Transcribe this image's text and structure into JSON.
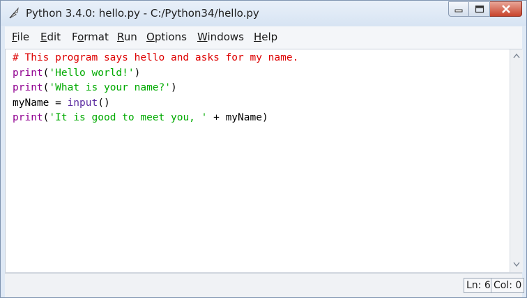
{
  "window": {
    "title": "Python 3.4.0: hello.py - C:/Python34/hello.py"
  },
  "menu": {
    "file": {
      "accel": "F",
      "rest": "ile"
    },
    "edit": {
      "accel": "E",
      "rest": "dit"
    },
    "format": {
      "pre": "F",
      "accel": "o",
      "rest": "rmat"
    },
    "run": {
      "accel": "R",
      "rest": "un"
    },
    "options": {
      "accel": "O",
      "rest": "ptions"
    },
    "windows": {
      "accel": "W",
      "rest": "indows"
    },
    "help": {
      "accel": "H",
      "rest": "elp"
    }
  },
  "code": {
    "line1": {
      "comment": "# This program says hello and asks for my name."
    },
    "line2": {
      "fn": "print",
      "open": "(",
      "str": "'Hello world!'",
      "close": ")"
    },
    "line3": {
      "fn": "print",
      "open": "(",
      "str": "'What is your name?'",
      "close": ")"
    },
    "line4": {
      "var": "myName = ",
      "fn": "input",
      "rest": "()"
    },
    "line5": {
      "fn": "print",
      "open": "(",
      "str": "'It is good to meet you, '",
      "rest": " + myName)"
    }
  },
  "status": {
    "line": "Ln: 6",
    "col": "Col: 0"
  },
  "icons": {
    "app": "python-feather-icon",
    "minimize": "minimize-icon",
    "maximize": "maximize-icon",
    "close": "close-icon"
  }
}
